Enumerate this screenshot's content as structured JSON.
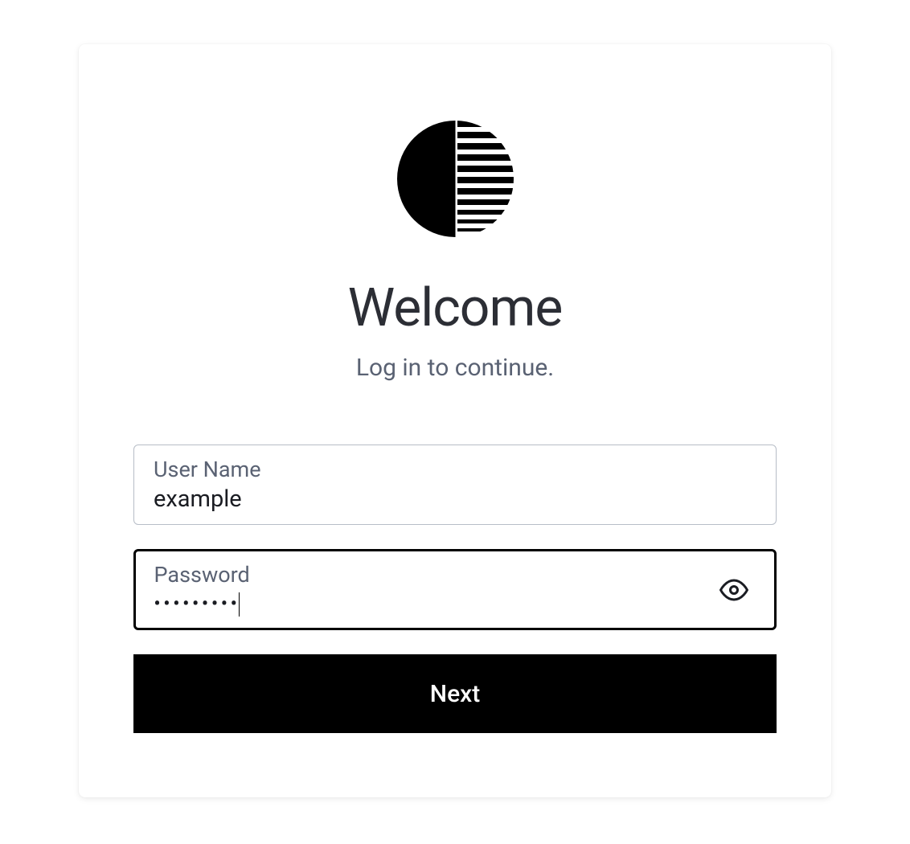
{
  "title": "Welcome",
  "subtitle": "Log in to continue.",
  "form": {
    "username": {
      "label": "User Name",
      "value": "example"
    },
    "password": {
      "label": "Password",
      "masked_value": "•••••••••"
    },
    "submit_label": "Next"
  },
  "icons": {
    "logo": "half-circle-stripes-logo",
    "eye": "eye-icon"
  }
}
